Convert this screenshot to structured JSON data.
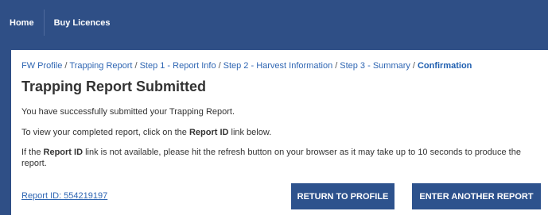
{
  "nav": {
    "items": [
      {
        "label": "Home"
      },
      {
        "label": "Buy Licences"
      }
    ]
  },
  "breadcrumb": {
    "items": [
      {
        "label": "FW Profile"
      },
      {
        "label": "Trapping Report"
      },
      {
        "label": "Step 1 - Report Info"
      },
      {
        "label": "Step 2 - Harvest Information"
      },
      {
        "label": "Step 3 - Summary"
      }
    ],
    "separator": "/",
    "current": "Confirmation"
  },
  "page": {
    "title": "Trapping Report Submitted",
    "message1": "You have successfully submitted your Trapping Report.",
    "message2_before": "To view your completed report, click on the ",
    "message2_bold": "Report ID",
    "message2_after": " link below.",
    "message3_before": "If the ",
    "message3_bold": "Report ID",
    "message3_after": " link is not available, please hit the refresh button on your browser as it may take up to 10 seconds to produce the report."
  },
  "report_link": {
    "label": "Report ID: 554219197"
  },
  "buttons": {
    "return_label": "RETURN TO PROFILE",
    "another_label": "ENTER ANOTHER REPORT"
  },
  "colors": {
    "nav_background": "#2f4f86",
    "button_background": "#2d528d",
    "link": "#2f66b3"
  }
}
